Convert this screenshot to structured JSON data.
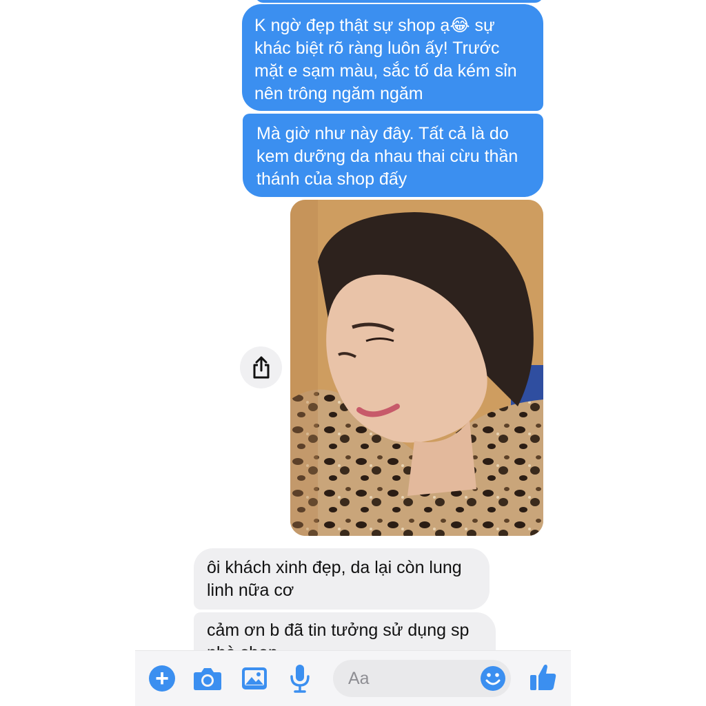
{
  "messages": {
    "sent_1": "K ngờ đẹp thật sự shop ạ😂 sự\nkhác biệt rõ ràng luôn ấy! Trước\nmặt e sạm màu, sắc tố da kém sỉn\nnên trông ngăm ngăm",
    "sent_2": "Mà giờ như này đây. Tất cả là do\nkem dưỡng da nhau thai cừu thần\nthánh của shop đấy",
    "received_1": "ôi khách xinh đẹp, da lại còn lung\nlinh nữa cơ",
    "received_2": "cảm ơn b đã tin tưởng sử dụng sp\nnhà shop"
  },
  "composer": {
    "placeholder": "Aa"
  },
  "icons": {
    "plus": "plus-icon",
    "camera": "camera-icon",
    "photo": "photo-icon",
    "mic": "mic-icon",
    "emoji": "smile-icon",
    "like": "thumbs-up-icon",
    "share": "share-icon"
  },
  "colors": {
    "sent_bubble": "#3b8ff0",
    "received_bubble": "#efeff1",
    "accent": "#3b8ff0"
  }
}
